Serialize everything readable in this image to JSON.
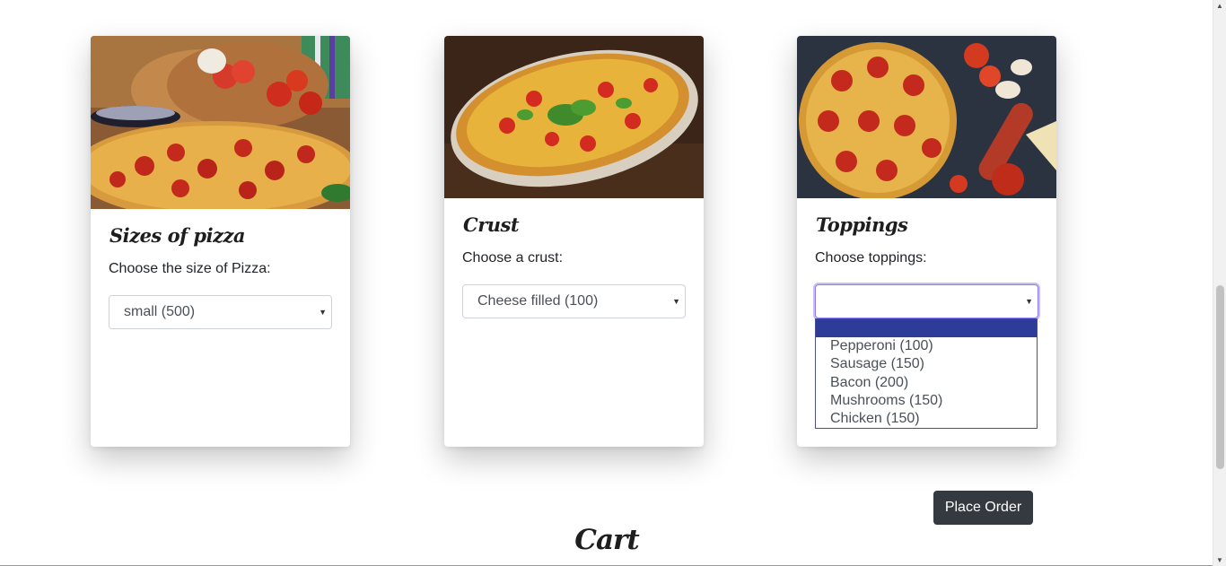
{
  "cards": [
    {
      "title": "Sizes of pizza",
      "prompt": "Choose the size of Pizza:",
      "selected": "small (500)",
      "image_icon": "pizza-photo-icon"
    },
    {
      "title": "Crust",
      "prompt": "Choose a crust:",
      "selected": "Cheese filled (100)",
      "image_icon": "pizza-photo-icon"
    },
    {
      "title": "Toppings",
      "prompt": "Choose toppings:",
      "selected": "",
      "image_icon": "pizza-photo-icon",
      "options": [
        "",
        "Pepperoni (100)",
        "Sausage (150)",
        "Bacon (200)",
        "Mushrooms (150)",
        "Chicken (150)"
      ]
    }
  ],
  "place_order_label": "Place Order",
  "cart_title": "Cart",
  "colors": {
    "button_bg": "#343a40",
    "dropdown_highlight": "#2d3c99",
    "focus_ring": "#8b7cf0"
  }
}
